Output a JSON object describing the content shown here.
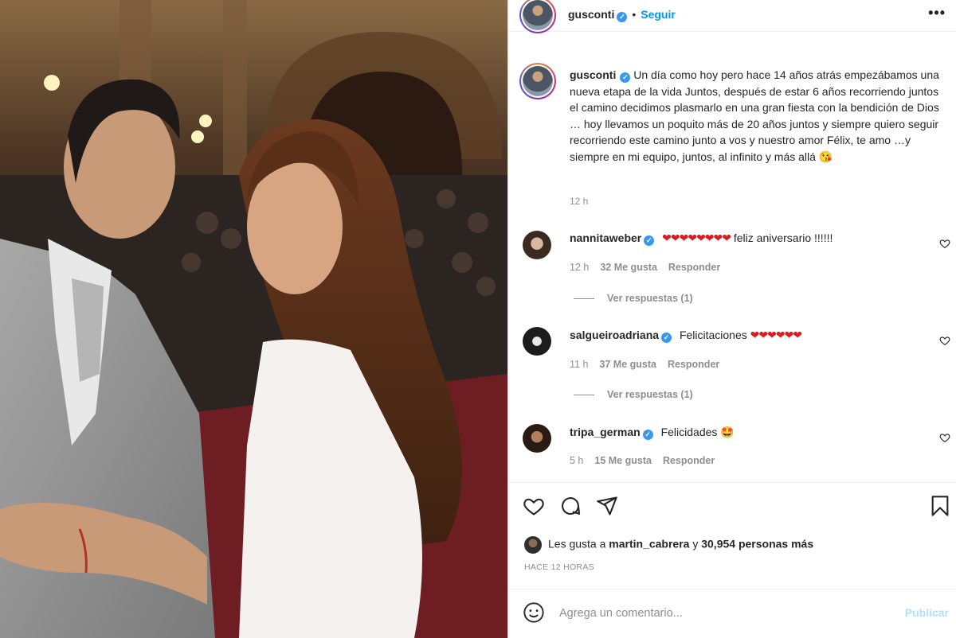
{
  "post": {
    "username": "gusconti",
    "follow_label": "Seguir",
    "more_label": "•••",
    "caption_text": "Un día como hoy pero hace 14 años atrás empezábamos una nueva etapa de la vida Juntos, después de estar 6 años recorriendo juntos el camino decidimos plasmarlo en una gran fiesta con la bendición de Dios … hoy llevamos un poquito más de 20 años juntos y siempre quiero seguir recorriendo este camino junto a vos y nuestro amor Félix, te amo …y siempre en mi equipo, juntos, al infinito y más allá 😘",
    "caption_time": "12 h"
  },
  "comments": [
    {
      "username": "nannitaweber",
      "hearts": "❤❤❤❤❤❤❤❤",
      "text": " feliz aniversario !!!!!!",
      "time": "12 h",
      "likes": "32 Me gusta",
      "reply": "Responder",
      "view_replies": "Ver respuestas (1)"
    },
    {
      "username": "salgueiroadriana",
      "text": "Felicitaciones ",
      "hearts": "❤❤❤❤❤❤",
      "time": "11 h",
      "likes": "37 Me gusta",
      "reply": "Responder",
      "view_replies": "Ver respuestas (1)"
    },
    {
      "username": "tripa_german",
      "text": "Felicidades 🤩",
      "time": "5 h",
      "likes": "15 Me gusta",
      "reply": "Responder"
    }
  ],
  "likes": {
    "prefix": "Les gusta a ",
    "user": "martin_cabrera",
    "middle": " y ",
    "count": "30,954 personas más"
  },
  "ago": "HACE 12 HORAS",
  "add_comment": {
    "placeholder": "Agrega un comentario...",
    "publish_label": "Publicar"
  },
  "colors": {
    "accent": "#0095f6",
    "verified": "#3897f0",
    "heart": "#e0181f",
    "muted": "#8e8e8e",
    "publish_disabled": "#b2dffc"
  },
  "icons": [
    "verified-icon",
    "more-icon",
    "heart-icon",
    "comment-icon",
    "share-icon",
    "bookmark-icon",
    "emoji-icon"
  ]
}
